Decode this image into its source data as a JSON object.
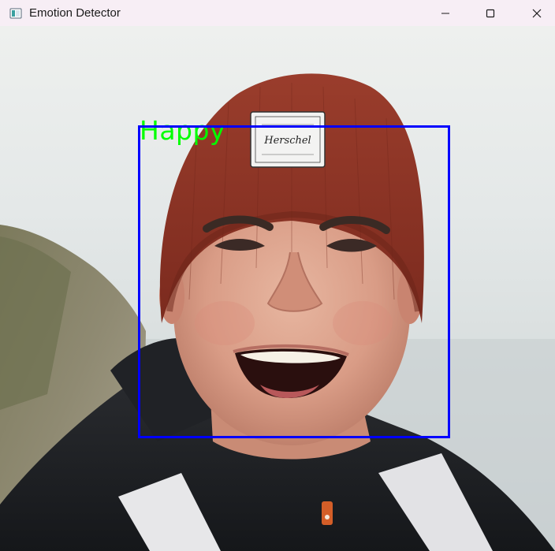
{
  "window": {
    "title": "Emotion Detector",
    "icon": "app-window-icon",
    "controls": [
      "minimize-icon",
      "maximize-icon",
      "close-icon"
    ]
  },
  "detection": {
    "label": "Happy",
    "label_color": "#00ff00",
    "box_color": "#0000ff"
  },
  "beanie_patch": {
    "brand": "Herschel"
  }
}
